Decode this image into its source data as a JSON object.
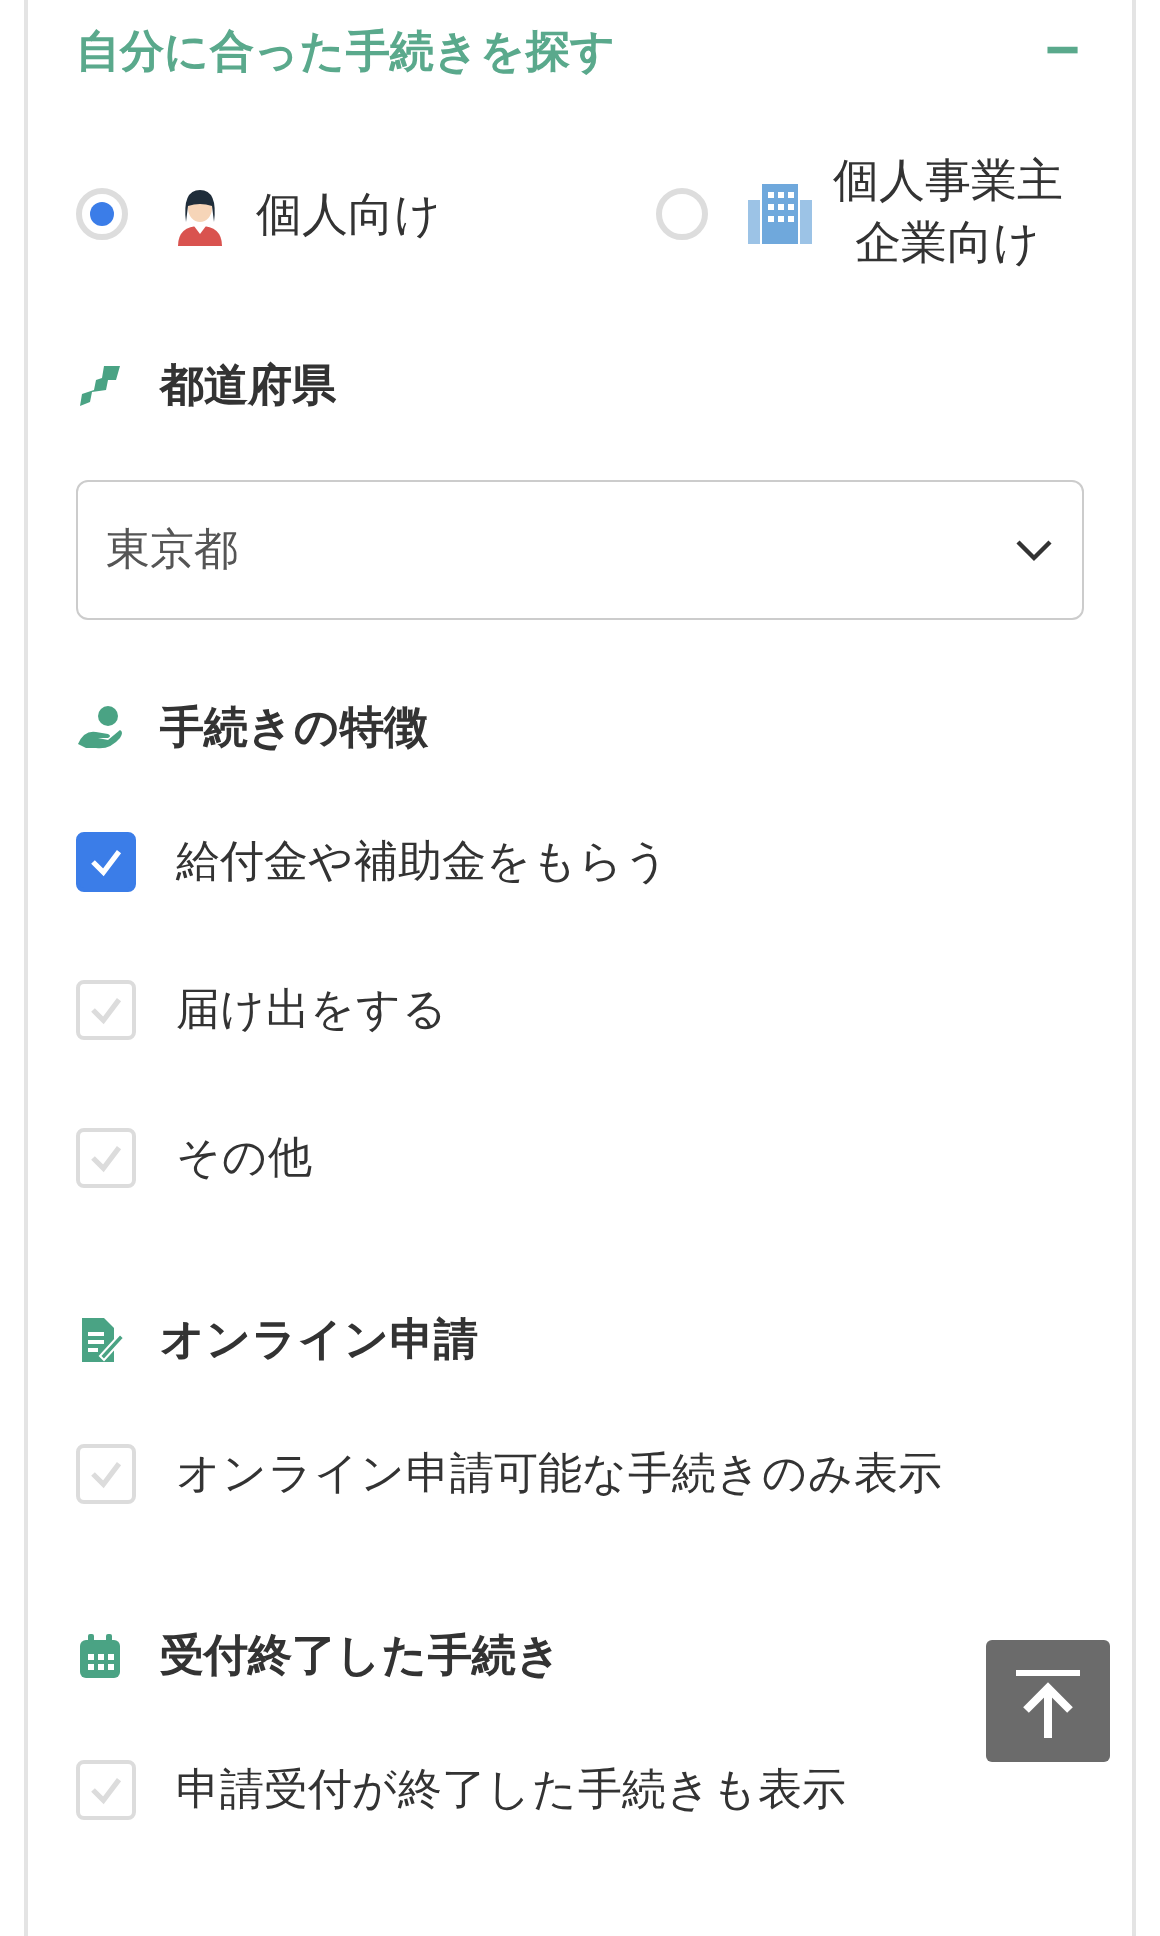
{
  "panel": {
    "title": "自分に合った手続きを探す",
    "collapse_symbol": "−"
  },
  "audience": [
    {
      "label": "個人向け",
      "selected": true
    },
    {
      "label": "個人事業主企業向け",
      "selected": false
    }
  ],
  "sections": [
    {
      "kind": "select",
      "heading": "都道府県",
      "value": "東京都"
    },
    {
      "kind": "checkboxes",
      "heading": "手続きの特徴",
      "options": [
        {
          "label": "給付金や補助金をもらう",
          "checked": true
        },
        {
          "label": "届け出をする",
          "checked": false
        },
        {
          "label": "その他",
          "checked": false
        }
      ]
    },
    {
      "kind": "checkboxes",
      "heading": "オンライン申請",
      "options": [
        {
          "label": "オンライン申請可能な手続きのみ表示",
          "checked": false
        }
      ]
    },
    {
      "kind": "checkboxes",
      "heading": "受付終了した手続き",
      "options": [
        {
          "label": "申請受付が終了した手続きも表示",
          "checked": false
        }
      ]
    }
  ]
}
